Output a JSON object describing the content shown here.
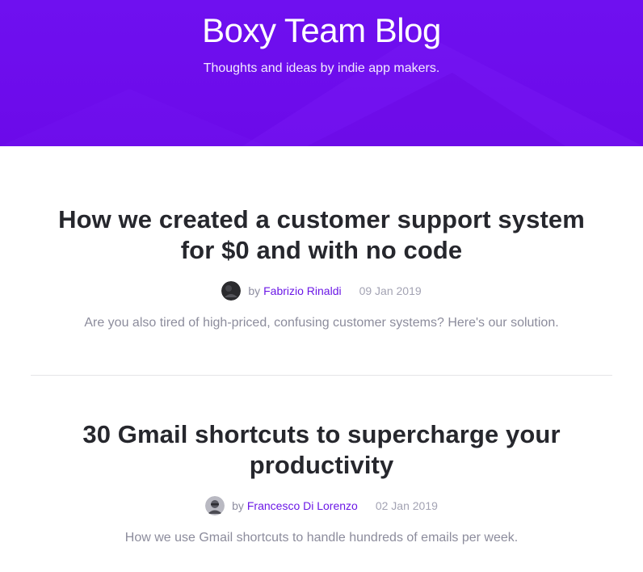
{
  "header": {
    "title": "Boxy Team Blog",
    "subtitle": "Thoughts and ideas by indie app makers."
  },
  "posts": [
    {
      "title": "How we created a customer support system for $0 and with no code",
      "by": "by",
      "author": "Fabrizio Rinaldi",
      "date": "09 Jan 2019",
      "excerpt": "Are you also tired of high-priced, confusing customer systems? Here's our solution."
    },
    {
      "title": "30 Gmail shortcuts to supercharge your productivity",
      "by": "by",
      "author": "Francesco Di Lorenzo",
      "date": "02 Jan 2019",
      "excerpt": "How we use Gmail shortcuts to handle hundreds of emails per week."
    }
  ],
  "colors": {
    "hero_background": "#6c0ae9",
    "author_link": "#6b17e6",
    "title_text": "#26272d",
    "muted_text": "#8c8c9c"
  }
}
